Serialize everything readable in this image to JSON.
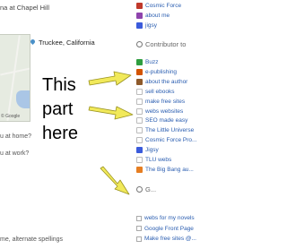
{
  "profile": {
    "cut_top": "na at Chapel Hill",
    "place": "Truckee, California",
    "map_credit": "© Google",
    "q_home": "u at home?",
    "q_work": "u at work?",
    "names": "me, alternate spellings"
  },
  "annotation": [
    "This",
    "part",
    "here"
  ],
  "sidebar": {
    "top_items": [
      {
        "label": "Cosmic Force",
        "color": "#c0392b"
      },
      {
        "label": "about me",
        "color": "#8e44ad"
      },
      {
        "label": "jigsy",
        "color": "#3b5bdb"
      }
    ],
    "contributor_heading": "Contributor to",
    "contributor_items": [
      {
        "label": "Buzz",
        "color": "#2e9e3f"
      },
      {
        "label": "e-publishing",
        "color": "#d35400"
      },
      {
        "label": "about the author",
        "color": "#8e5a2b"
      },
      {
        "label": "sell ebooks",
        "color": "#ffffff"
      },
      {
        "label": "make free sites",
        "color": "#ffffff"
      },
      {
        "label": "webs websites",
        "color": "#ffffff"
      },
      {
        "label": "SEO made easy",
        "color": "#ffffff"
      },
      {
        "label": "The Little Universe",
        "color": "#ffffff"
      },
      {
        "label": "Cosmic Force Pro...",
        "color": "#ffffff"
      },
      {
        "label": "Jigsy",
        "color": "#3b5bdb"
      },
      {
        "label": "TLU webs",
        "color": "#ffffff"
      },
      {
        "label": "The Big Bang au...",
        "color": "#e67e22"
      }
    ],
    "second_heading": "G...",
    "link_items": [
      {
        "label": "webs for my novels"
      },
      {
        "label": "Google Front Page"
      },
      {
        "label": "Make free sites @..."
      }
    ]
  }
}
